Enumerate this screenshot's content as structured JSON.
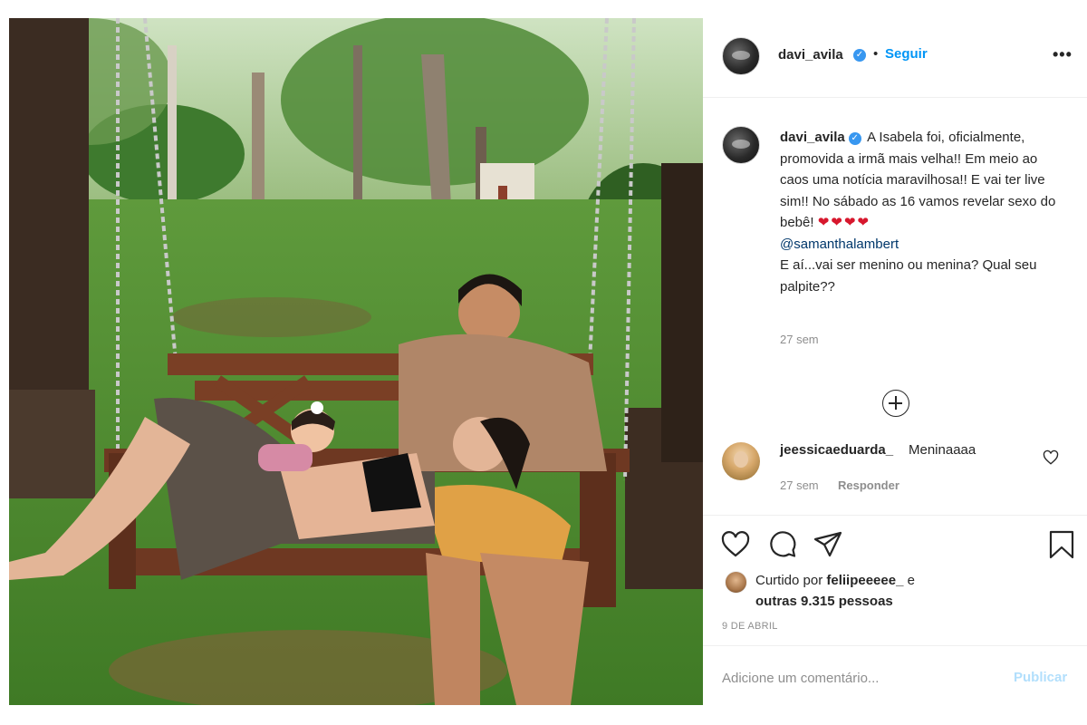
{
  "post": {
    "author": {
      "username": "davi_avila",
      "verified_icon": "verified-badge-icon",
      "follow_label": "Seguir",
      "separator": "•",
      "more_label": "•••"
    },
    "caption": {
      "username": "davi_avila",
      "text": "A Isabela foi, oficialmente, promovida a irmã mais velha!! Em meio ao caos uma notícia maravilhosa!! E vai ter live sim!! No sábado as 16 vamos revelar sexo do bebê!",
      "hearts": "❤❤❤❤",
      "mention": "@samanthalambert",
      "question": "E aí...vai ser menino ou menina? Qual seu palpite??",
      "time": "27 sem"
    },
    "load_more_icon": "plus-circle-icon",
    "comments": [
      {
        "username": "jeessicaeduarda_",
        "text": "Meninaaaa",
        "time": "27 sem",
        "reply_label": "Responder"
      }
    ],
    "actions": {
      "icons": [
        "heart-icon",
        "comment-icon",
        "share-icon",
        "bookmark-icon"
      ]
    },
    "likes": {
      "prefix": "Curtido por",
      "user": "feliipeeeee_",
      "conjunction": "e",
      "others": "outras 9.315 pessoas"
    },
    "date": "9 DE ABRIL",
    "add_comment": {
      "placeholder": "Adicione um comentário...",
      "publish_label": "Publicar"
    },
    "colors": {
      "link_blue": "#0095f6",
      "verified_blue": "#3897f0",
      "publish_disabled": "#b2dffc",
      "secondary_text": "#8e8e8e",
      "heart_red": "#d7172d"
    }
  }
}
